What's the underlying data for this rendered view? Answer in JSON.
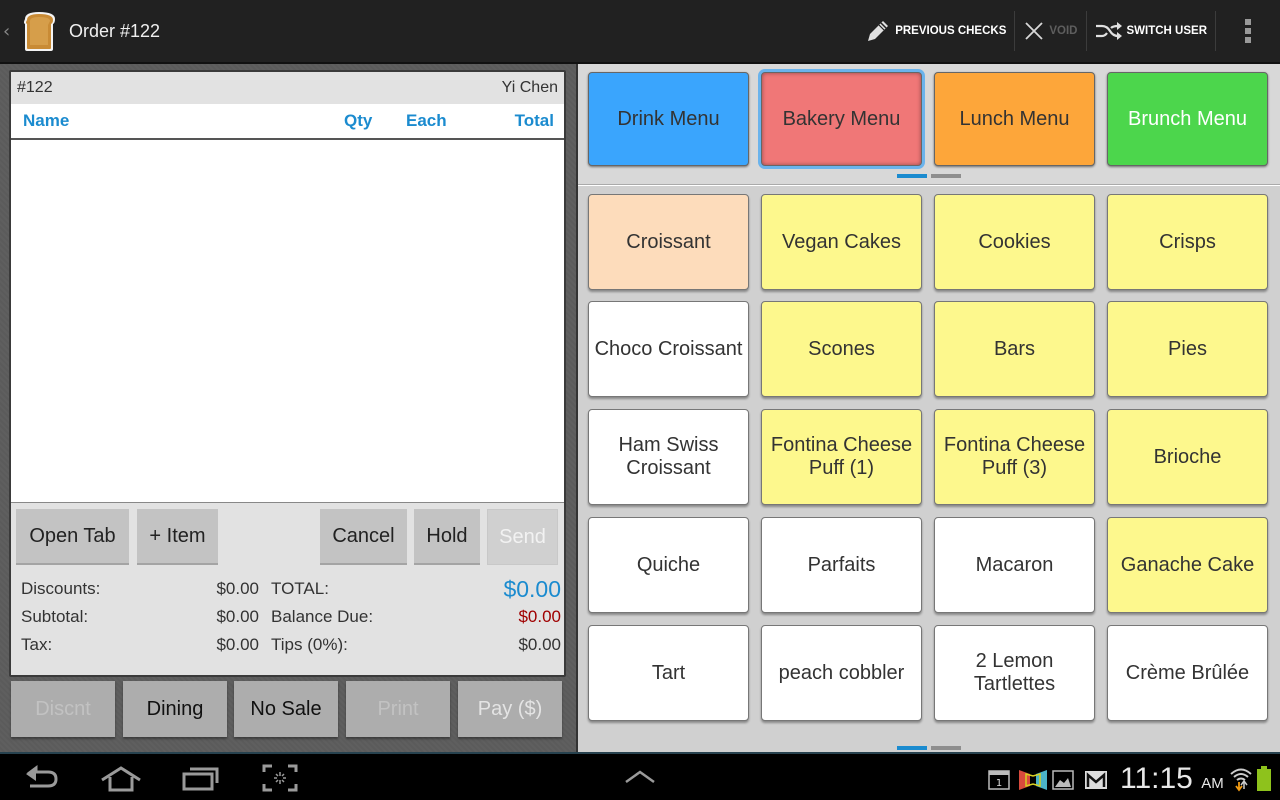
{
  "actionbar": {
    "title": "Order #122",
    "actions": [
      {
        "label": "PREVIOUS CHECKS",
        "icon": "pencil-icon",
        "enabled": true
      },
      {
        "label": "VOID",
        "icon": "close-icon",
        "enabled": false
      },
      {
        "label": "SWITCH USER",
        "icon": "shuffle-icon",
        "enabled": true
      }
    ],
    "overflow_icon": "overflow-menu-icon"
  },
  "order": {
    "number": "#122",
    "server": "Yi Chen",
    "columns": {
      "name": "Name",
      "qty": "Qty",
      "each": "Each",
      "total": "Total"
    },
    "items": [],
    "buttons": {
      "open_tab": "Open Tab",
      "add_item": "+ Item",
      "cancel": "Cancel",
      "hold": "Hold",
      "send": "Send"
    },
    "totals": {
      "discounts_label": "Discounts:",
      "discounts": "$0.00",
      "subtotal_label": "Subtotal:",
      "subtotal": "$0.00",
      "tax_label": "Tax:",
      "tax": "$0.00",
      "total_label": "TOTAL:",
      "total": "$0.00",
      "balance_label": "Balance Due:",
      "balance": "$0.00",
      "tips_label": "Tips (0%):",
      "tips": "$0.00"
    },
    "footer_buttons": {
      "discount": "Discnt",
      "dining": "Dining",
      "no_sale": "No Sale",
      "print": "Print",
      "pay": "Pay ($)"
    }
  },
  "menus": [
    {
      "label": "Drink Menu",
      "color": "#3aa5fd",
      "text_color": "#333333"
    },
    {
      "label": "Bakery Menu",
      "color": "#f07777",
      "text_color": "#333333",
      "selected": true
    },
    {
      "label": "Lunch Menu",
      "color": "#fda63a",
      "text_color": "#333333"
    },
    {
      "label": "Brunch Menu",
      "color": "#4cd64c",
      "text_color": "#ffffff"
    }
  ],
  "menu_pager": {
    "current": 1,
    "total": 2
  },
  "items_pager": {
    "current": 1,
    "total": 2
  },
  "items": [
    {
      "label": "Croissant",
      "color": "#fddcbb"
    },
    {
      "label": "Vegan Cakes",
      "color": "#fdf88d"
    },
    {
      "label": "Cookies",
      "color": "#fdf88d"
    },
    {
      "label": "Crisps",
      "color": "#fdf88d"
    },
    {
      "label": "Choco Croissant",
      "color": "#ffffff"
    },
    {
      "label": "Scones",
      "color": "#fdf88d"
    },
    {
      "label": "Bars",
      "color": "#fdf88d"
    },
    {
      "label": "Pies",
      "color": "#fdf88d"
    },
    {
      "label": "Ham Swiss\nCroissant",
      "color": "#ffffff"
    },
    {
      "label": "Fontina Cheese\nPuff (1)",
      "color": "#fdf88d"
    },
    {
      "label": "Fontina Cheese\nPuff (3)",
      "color": "#fdf88d"
    },
    {
      "label": "Brioche",
      "color": "#fdf88d"
    },
    {
      "label": "Quiche",
      "color": "#ffffff"
    },
    {
      "label": "Parfaits",
      "color": "#ffffff"
    },
    {
      "label": "Macaron",
      "color": "#ffffff"
    },
    {
      "label": "Ganache Cake",
      "color": "#fdf88d"
    },
    {
      "label": "Tart",
      "color": "#ffffff"
    },
    {
      "label": "peach cobbler",
      "color": "#ffffff"
    },
    {
      "label": "2 Lemon\nTartlettes",
      "color": "#ffffff"
    },
    {
      "label": "Crème Brûlée",
      "color": "#ffffff"
    }
  ],
  "system_bar": {
    "time": "11:15",
    "ampm": "AM",
    "nav_icons": [
      "back-icon",
      "home-icon",
      "recent-apps-icon",
      "screenshot-icon"
    ],
    "status_icons": [
      "calendar-icon",
      "app-notification-icon",
      "gallery-icon",
      "gmail-icon",
      "wifi-icon",
      "battery-icon"
    ],
    "calendar_day": "1"
  }
}
